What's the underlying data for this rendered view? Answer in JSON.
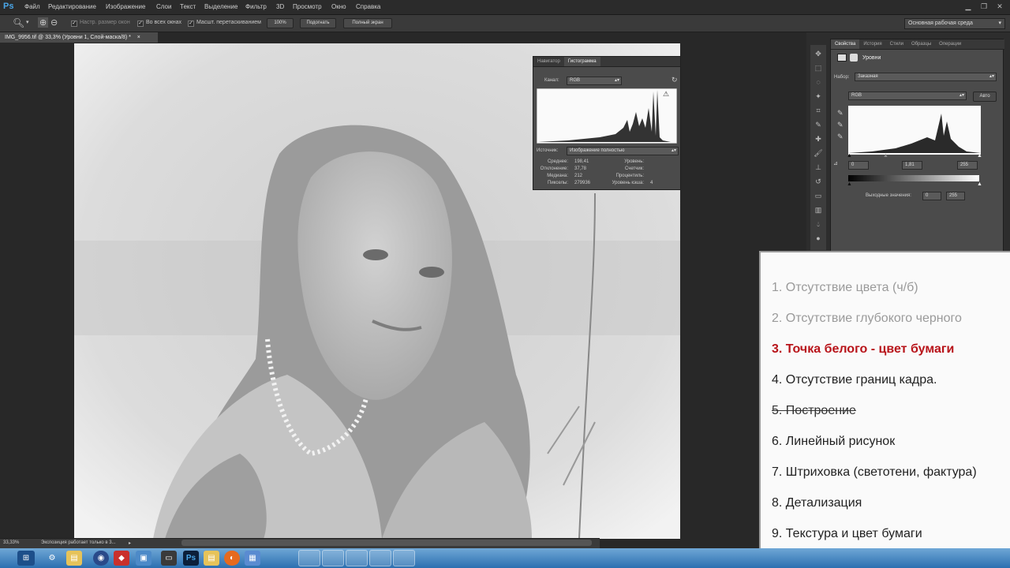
{
  "app": {
    "logo": "Ps"
  },
  "menu": [
    "Файл",
    "Редактирование",
    "Изображение",
    "Слои",
    "Текст",
    "Выделение",
    "Фильтр",
    "3D",
    "Просмотр",
    "Окно",
    "Справка"
  ],
  "options": {
    "resize_windows": "Настр. размер окон",
    "all_windows": "Во всех окнах",
    "scrubby_zoom": "Масшт. перетаскиванием",
    "zoom_100": "100%",
    "fit": "Подогнать",
    "fullscreen": "Полный экран",
    "workspace": "Основная рабочая среда"
  },
  "document": {
    "tab": "IMG_9956.tif @ 33,3% (Уровни 1, Слой-маска/8) *"
  },
  "histogram": {
    "tabs": [
      "Навигатор",
      "Гистограмма"
    ],
    "channel_label": "Канал:",
    "channel": "RGB",
    "source_label": "Источник:",
    "source": "Изображение полностью",
    "stats_left": [
      {
        "label": "Среднее:",
        "value": "198,41"
      },
      {
        "label": "Отклонение:",
        "value": "37,78"
      },
      {
        "label": "Медиана:",
        "value": "212"
      },
      {
        "label": "Пикселы:",
        "value": "279936"
      }
    ],
    "stats_right": [
      {
        "label": "Уровень:",
        "value": ""
      },
      {
        "label": "Счетчик:",
        "value": ""
      },
      {
        "label": "Процентиль:",
        "value": ""
      },
      {
        "label": "Уровень кэша:",
        "value": "4"
      }
    ]
  },
  "properties": {
    "tabs": [
      "Свойства",
      "История",
      "Стили",
      "Образцы",
      "Операции"
    ],
    "title": "Уровни",
    "preset_label": "Набор:",
    "preset": "Заказная",
    "channel": "RGB",
    "auto": "Авто",
    "input_values": [
      "0",
      "1,81",
      "255"
    ],
    "output_label": "Выходные значения:",
    "output_values": [
      "0",
      "255"
    ]
  },
  "status": {
    "zoom": "33,33%",
    "info": "Экспозиция работает только в 3..."
  },
  "checklist": [
    {
      "text": "1. Отсутствие цвета (ч/б)",
      "style": "gray"
    },
    {
      "text": "2. Отсутствие глубокого черного",
      "style": "gray"
    },
    {
      "text": "3. Точка белого - цвет бумаги",
      "style": "red"
    },
    {
      "text": "4. Отсутствие границ кадра.",
      "style": "dark"
    },
    {
      "text": "5. Построение",
      "style": "strike"
    },
    {
      "text": "6. Линейный рисунок",
      "style": "dark"
    },
    {
      "text": "7. Штриховка (светотени, фактура)",
      "style": "dark"
    },
    {
      "text": "8. Детализация",
      "style": "dark"
    },
    {
      "text": "9. Текстура и цвет бумаги",
      "style": "dark"
    }
  ],
  "colors": {
    "accent_red": "#b8141a",
    "taskbar": "#2b6fb0",
    "ps_blue": "#4aa6e8"
  }
}
